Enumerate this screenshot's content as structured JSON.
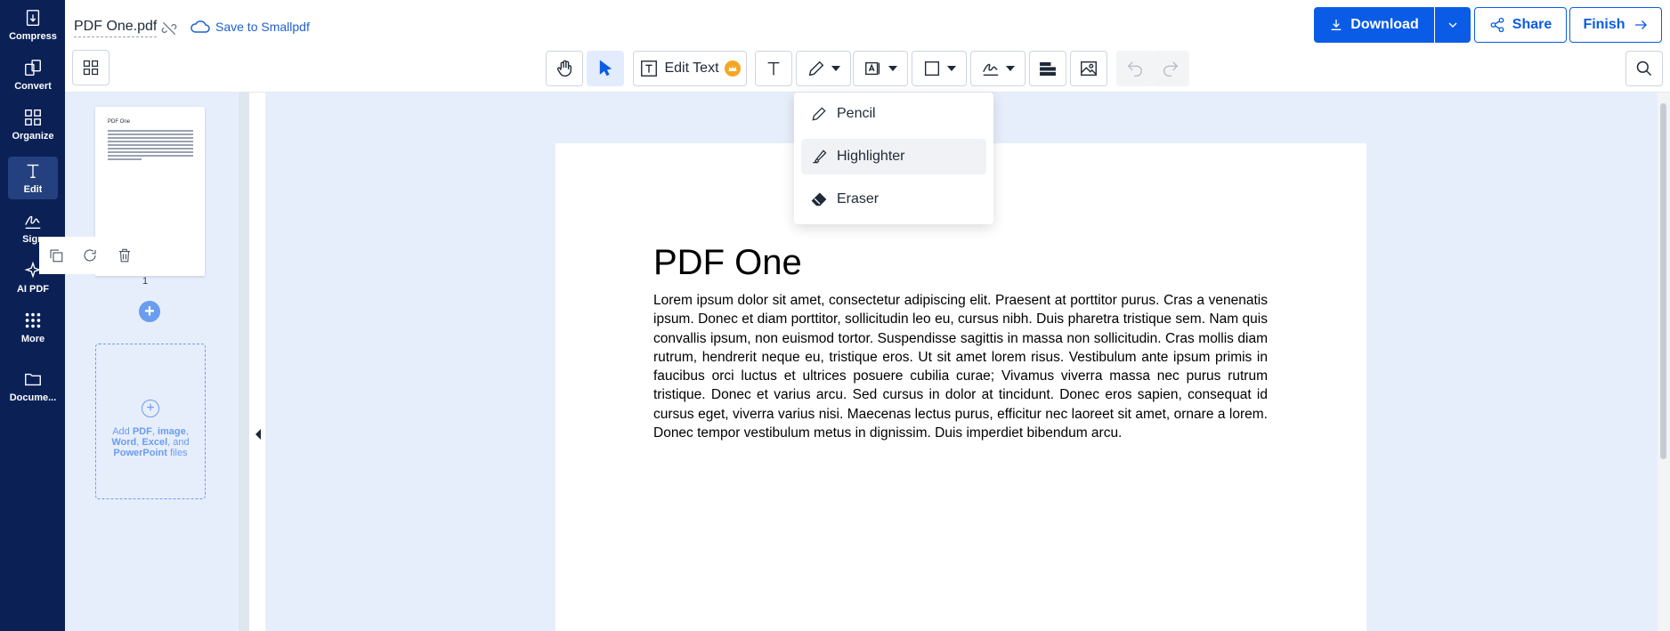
{
  "sidebar": {
    "items": [
      {
        "label": "Compress",
        "icon": "compress-icon"
      },
      {
        "label": "Convert",
        "icon": "convert-icon"
      },
      {
        "label": "Organize",
        "icon": "organize-icon"
      },
      {
        "label": "Edit",
        "icon": "edit-text-icon"
      },
      {
        "label": "Sign",
        "icon": "sign-icon"
      },
      {
        "label": "AI PDF",
        "icon": "sparkle-icon"
      },
      {
        "label": "More",
        "icon": "more-grid-icon"
      },
      {
        "label": "Docume...",
        "icon": "folder-icon"
      }
    ]
  },
  "header": {
    "filename": "PDF One.pdf",
    "save_label": "Save to Smallpdf",
    "download_label": "Download",
    "share_label": "Share",
    "finish_label": "Finish"
  },
  "toolbar": {
    "edit_text_label": "Edit Text"
  },
  "draw_menu": {
    "items": [
      {
        "label": "Pencil",
        "icon": "pencil-icon"
      },
      {
        "label": "Highlighter",
        "icon": "highlighter-icon"
      },
      {
        "label": "Eraser",
        "icon": "eraser-icon"
      }
    ]
  },
  "thumbnails": {
    "thumb_title": "PDF One",
    "page_number": "1",
    "dropzone_text_1": "Add ",
    "dropzone_pdf": "PDF",
    "dropzone_sep1": ", ",
    "dropzone_image": "image",
    "dropzone_sep2": ",",
    "dropzone_word": "Word",
    "dropzone_sep3": ", ",
    "dropzone_excel": "Excel",
    "dropzone_and": ", and",
    "dropzone_ppt": "PowerPoint",
    "dropzone_files": " files"
  },
  "document": {
    "title": "PDF One",
    "body": "Lorem ipsum dolor sit amet, consectetur adipiscing elit. Praesent at porttitor purus. Cras a venenatis ipsum. Donec et diam porttitor, sollicitudin leo eu, cursus nibh. Duis pharetra tristique sem. Nam quis convallis ipsum, non euismod tortor. Suspendisse sagittis in massa non sollicitudin. Cras mollis diam rutrum, hendrerit neque eu, tristique eros. Ut sit amet lorem risus. Vestibulum ante ipsum primis in faucibus orci luctus et ultrices posuere cubilia curae; Vivamus viverra massa nec purus rutrum tristique. Donec et varius arcu. Sed cursus in dolor at tincidunt. Donec eros sapien, consequat id cursus eget, viverra varius nisi. Maecenas lectus purus, efficitur nec laoreet sit amet, ornare a lorem. Donec tempor vestibulum metus in dignissim. Duis imperdiet bibendum arcu."
  },
  "colors": {
    "sidebar_bg": "#0b2156",
    "accent": "#0a5ce6",
    "canvas_bg": "#e7eefb"
  }
}
